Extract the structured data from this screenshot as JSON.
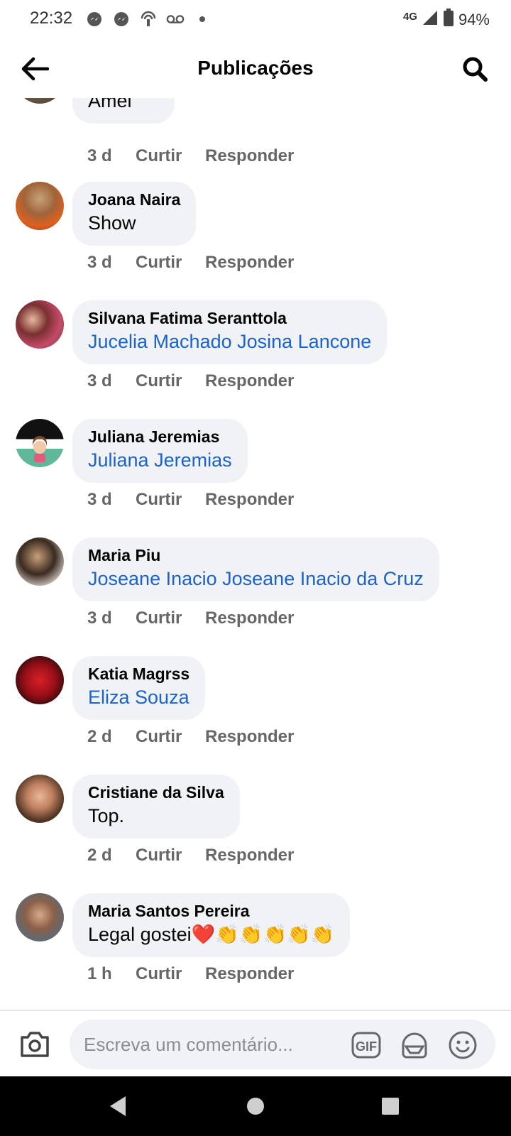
{
  "status": {
    "time": "22:32",
    "network": "4G",
    "battery": "94%"
  },
  "header": {
    "title": "Publicações"
  },
  "comments": [
    {
      "name": "",
      "text": "Amei",
      "link": false,
      "time": "3 d",
      "like": "Curtir",
      "reply": "Responder"
    },
    {
      "name": "Joana Naira",
      "text": "Show",
      "link": false,
      "time": "3 d",
      "like": "Curtir",
      "reply": "Responder"
    },
    {
      "name": "Silvana Fatima Seranttola",
      "text": "Jucelia Machado Josina Lancone",
      "link": true,
      "time": "3 d",
      "like": "Curtir",
      "reply": "Responder"
    },
    {
      "name": "Juliana Jeremias",
      "text": "Juliana Jeremias",
      "link": true,
      "time": "3 d",
      "like": "Curtir",
      "reply": "Responder"
    },
    {
      "name": "Maria Piu",
      "text": "Joseane Inacio Joseane Inacio da Cruz",
      "link": true,
      "time": "3 d",
      "like": "Curtir",
      "reply": "Responder"
    },
    {
      "name": "Katia Magrss",
      "text": "Eliza Souza",
      "link": true,
      "time": "2 d",
      "like": "Curtir",
      "reply": "Responder"
    },
    {
      "name": "Cristiane da Silva",
      "text": "Top.",
      "link": false,
      "time": "2 d",
      "like": "Curtir",
      "reply": "Responder"
    },
    {
      "name": "Maria Santos Pereira",
      "text": "Legal gostei❤️👏👏👏👏👏",
      "link": false,
      "time": "1 h",
      "like": "Curtir",
      "reply": "Responder"
    }
  ],
  "composer": {
    "placeholder": "Escreva um comentário...",
    "gif_label": "GIF"
  },
  "colors": {
    "link": "#1b63c9",
    "bubble": "#f0f2f5",
    "meta": "#65676b"
  }
}
